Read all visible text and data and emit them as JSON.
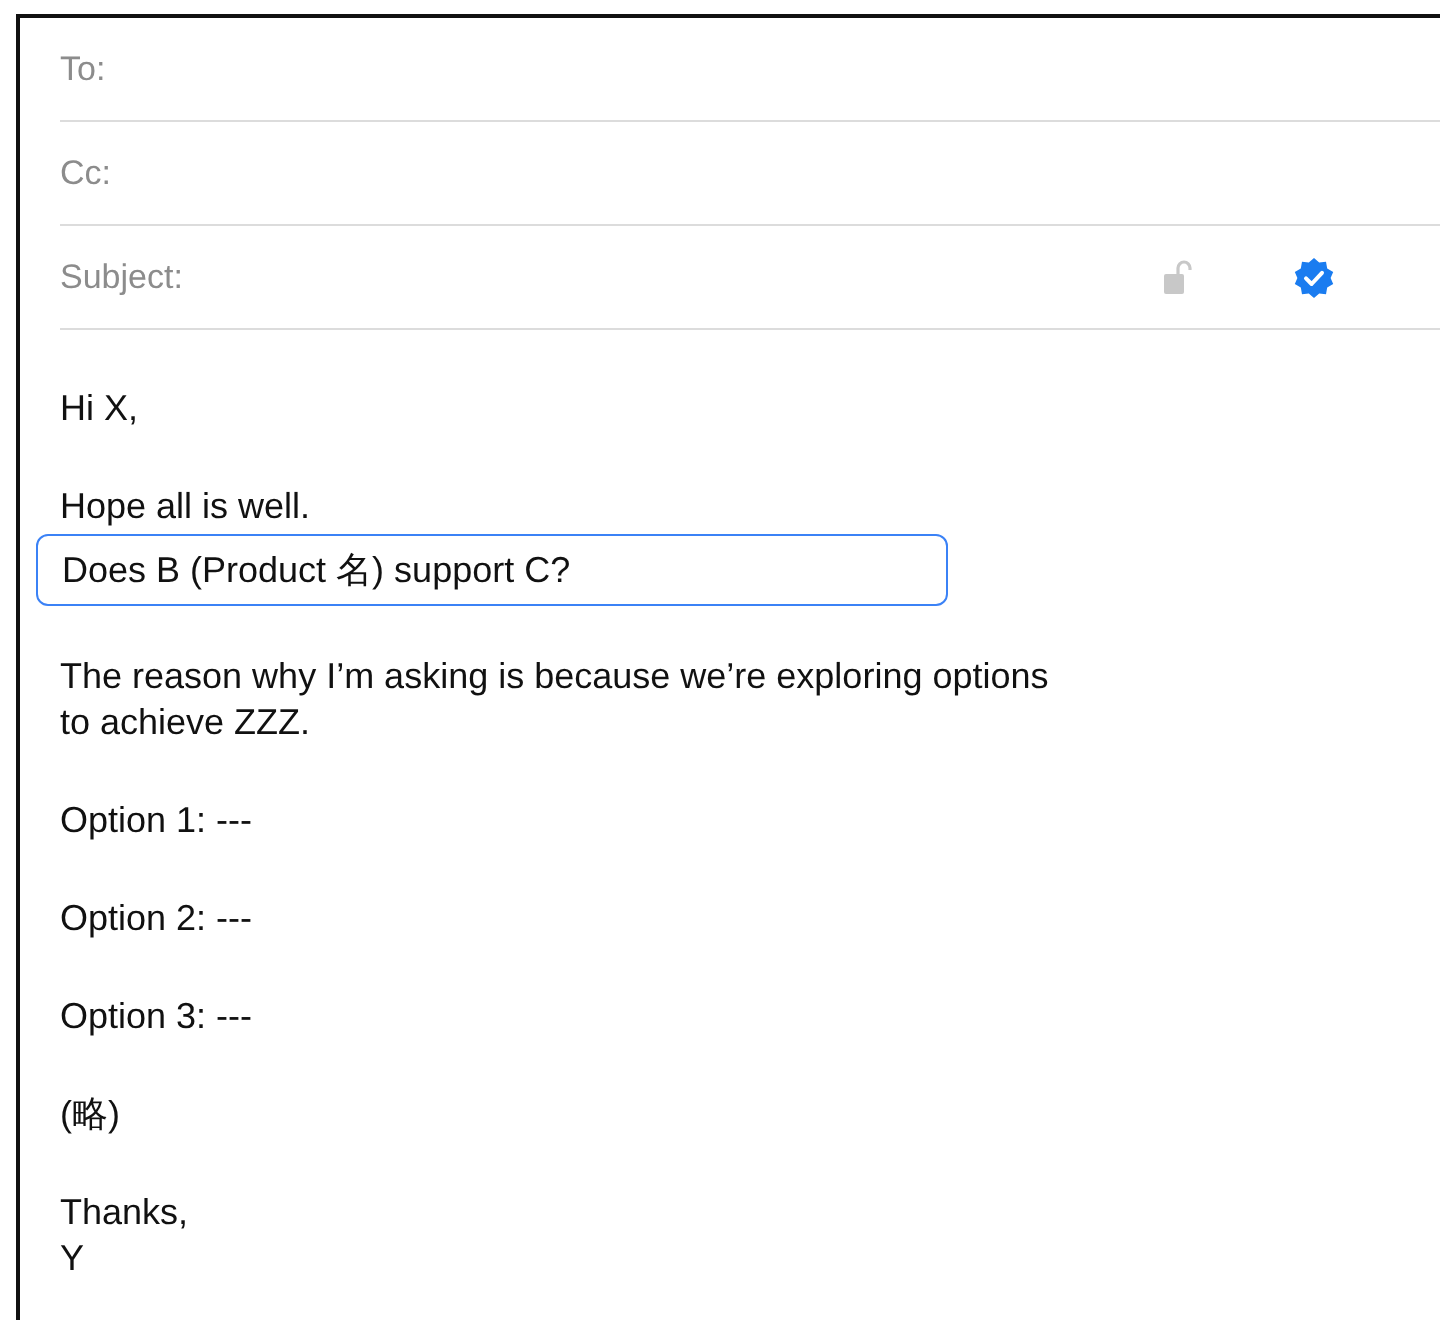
{
  "header_fields": [
    {
      "label": "To:",
      "kind": "address"
    },
    {
      "label": "Cc:",
      "kind": "address"
    },
    {
      "label": "Subject:",
      "kind": "subject"
    }
  ],
  "body": [
    {
      "lines": [
        {
          "text": "Hi X,",
          "highlighted": false
        }
      ]
    },
    {
      "lines": [
        {
          "text": "Hope all is well.",
          "highlighted": false
        },
        {
          "text": "Does B (Product 名) support C?",
          "highlighted": true
        }
      ]
    },
    {
      "lines": [
        {
          "text": "The reason why I’m asking is because we’re exploring options",
          "highlighted": false
        },
        {
          "text": "to achieve ZZZ.",
          "highlighted": false
        }
      ]
    },
    {
      "lines": [
        {
          "text": "Option 1: ---",
          "highlighted": false
        }
      ]
    },
    {
      "lines": [
        {
          "text": "Option 2: ---",
          "highlighted": false
        }
      ]
    },
    {
      "lines": [
        {
          "text": "Option 3: ---",
          "highlighted": false
        }
      ]
    },
    {
      "lines": [
        {
          "text": "(略)",
          "highlighted": false
        }
      ]
    },
    {
      "lines": [
        {
          "text": "Thanks,",
          "highlighted": false
        },
        {
          "text": "Y",
          "highlighted": false
        }
      ]
    }
  ]
}
